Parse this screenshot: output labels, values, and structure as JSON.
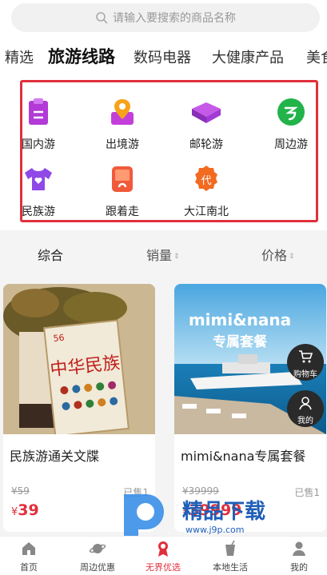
{
  "search": {
    "placeholder": "请输入要搜索的商品名称",
    "icon": "search-icon"
  },
  "tabs": [
    "精选",
    "旅游线路",
    "数码电器",
    "大健康产品",
    "美食"
  ],
  "active_tab": "旅游线路",
  "categories": [
    {
      "label": "国内游",
      "icon": "clipboard-icon",
      "color": "#b23ad6"
    },
    {
      "label": "出境游",
      "icon": "location-pin-icon",
      "color": "#f7a21b"
    },
    {
      "label": "邮轮游",
      "icon": "cube-icon",
      "color": "#a23ad6"
    },
    {
      "label": "周边游",
      "icon": "circle-logo-icon",
      "color": "#22b34a"
    },
    {
      "label": "民族游",
      "icon": "shirt-icon",
      "color": "#8f49e6"
    },
    {
      "label": "跟着走",
      "icon": "tablet-icon",
      "color": "#f05a3a"
    },
    {
      "label": "大江南北",
      "icon": "dai-badge-icon",
      "color": "#f26b21",
      "badge": "代"
    }
  ],
  "sort": {
    "comprehensive": "综合",
    "sales": "销量",
    "price": "价格"
  },
  "products": [
    {
      "name": "民族游通关文牒",
      "old_price": "¥59",
      "sold": "已售1",
      "price_symbol": "¥",
      "price": "39",
      "image_text": "中华民族",
      "image_number": "56"
    },
    {
      "name": "mimi&nana专属套餐",
      "old_price": "¥39999",
      "sold": "已售1",
      "price_symbol": "¥",
      "price": "39999",
      "image_title": "mimi&nana",
      "image_subtitle": "专属套餐"
    }
  ],
  "floating": {
    "cart": "购物车",
    "mine": "我的"
  },
  "watermark": {
    "brand": "精品下载",
    "url": "www.j9p.com"
  },
  "nav": [
    {
      "label": "首页",
      "icon": "home-icon"
    },
    {
      "label": "周边优惠",
      "icon": "planet-icon"
    },
    {
      "label": "无界优选",
      "icon": "ribbon-icon",
      "active": true
    },
    {
      "label": "本地生活",
      "icon": "drink-icon"
    },
    {
      "label": "我的",
      "icon": "user-icon"
    }
  ],
  "colors": {
    "accent": "#e0303c"
  }
}
